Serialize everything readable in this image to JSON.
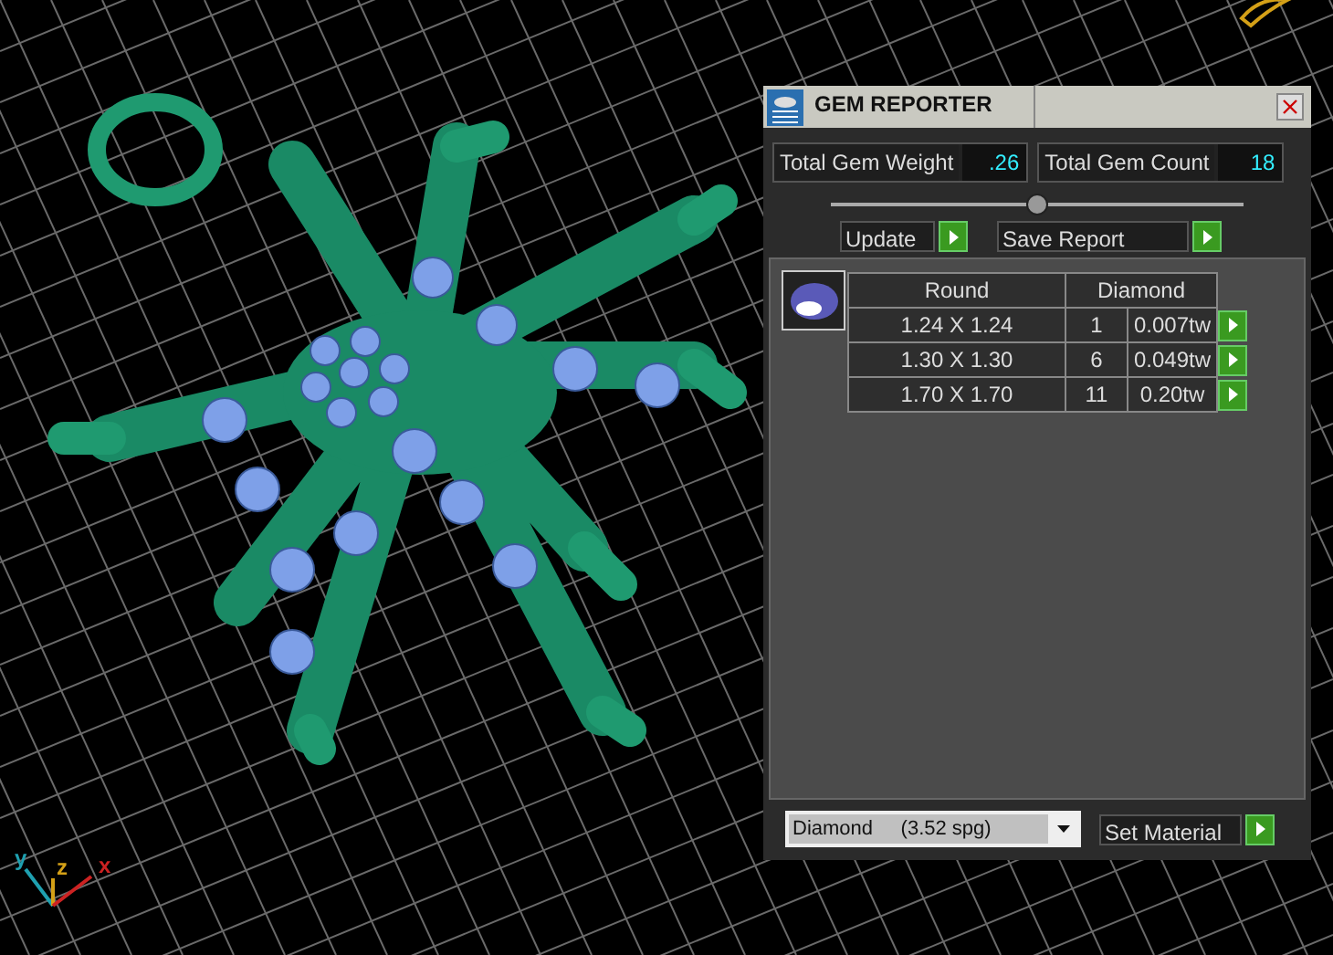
{
  "window": {
    "title": "GEM REPORTER"
  },
  "totals": [
    {
      "label": "Total Gem Weight",
      "value": ".26"
    },
    {
      "label": "Total Gem Count",
      "value": "18"
    }
  ],
  "slider": {
    "level": 0.5
  },
  "buttons": [
    "Update",
    "Save Report"
  ],
  "table": {
    "columns": [
      "Round",
      "Diamond"
    ],
    "rows": [
      {
        "size": "1.24 X 1.24",
        "count": "1",
        "weight": "0.007tw"
      },
      {
        "size": "1.30 X 1.30",
        "count": "6",
        "weight": "0.049tw"
      },
      {
        "size": "1.70 X 1.70",
        "count": "11",
        "weight": "0.20tw"
      }
    ]
  },
  "material": {
    "value": "Diamond     (3.52 spg)",
    "button": "Set Material"
  },
  "axes": [
    {
      "label": "y",
      "color": "#1fa0b0"
    },
    {
      "label": "z",
      "color": "#d4a017"
    },
    {
      "label": "x",
      "color": "#cc2222"
    }
  ]
}
